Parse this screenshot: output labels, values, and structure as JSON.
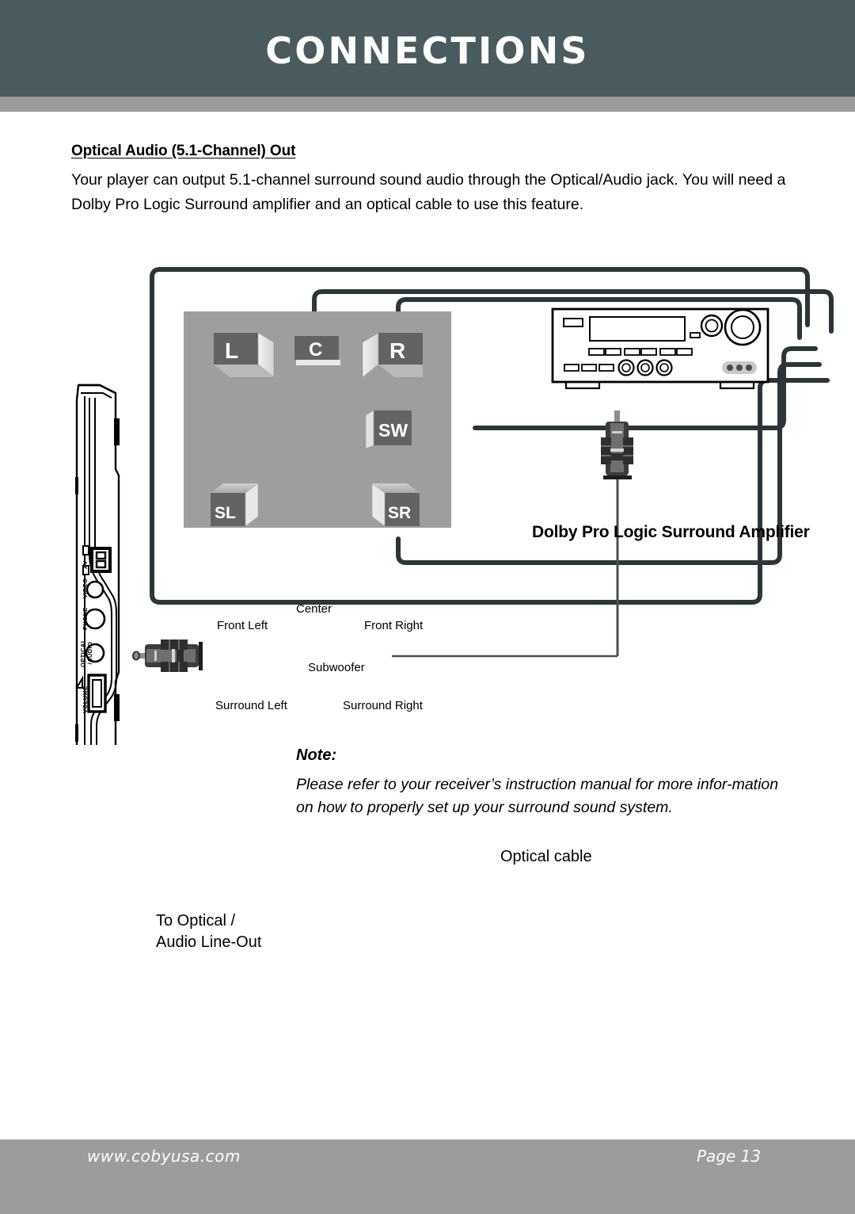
{
  "header": {
    "title": "CONNECTIONS"
  },
  "content": {
    "section_heading": "Optical Audio (5.1-Channel) Out",
    "paragraph": "Your player can output 5.1-channel surround sound audio through the Optical/Audio jack. You will need a Dolby Pro Logic Surround amplifier and an optical cable to use this feature."
  },
  "diagram": {
    "amplifier_title": "Dolby Pro Logic Surround Amplifier",
    "speakers": [
      {
        "code": "L",
        "label": "Front Left"
      },
      {
        "code": "C",
        "label": "Center"
      },
      {
        "code": "R",
        "label": "Front Right"
      },
      {
        "code": "SW",
        "label": "Subwoofer"
      },
      {
        "code": "SL",
        "label": "Surround Left"
      },
      {
        "code": "SR",
        "label": "Surround Right"
      }
    ],
    "cable_label": "Optical cable",
    "jack_label_line1": "To Optical /",
    "jack_label_line2": "Audio Line-Out",
    "player_ports": [
      {
        "name": "av",
        "label": "AV"
      },
      {
        "name": "video",
        "label": "VIDEO"
      },
      {
        "name": "phone",
        "label": "PHONE"
      },
      {
        "name": "optical-audio",
        "label": "OPTICAL\n/AUDIO"
      },
      {
        "name": "volume",
        "label": "VOLUME"
      }
    ]
  },
  "note": {
    "label": "Note:",
    "text": "Please refer to your receiver’s instruction manual for more infor-mation on how to properly set up your surround sound system."
  },
  "footer": {
    "url": "www.cobyusa.com",
    "page": "Page 13"
  },
  "colors": {
    "header_band": "#4a5b5f",
    "header_rule": "#9a9a9a",
    "footer_band": "#9c9c9c",
    "room_fill": "#9e9e9e",
    "speaker_dark": "#636363",
    "wire": "#2b3638"
  }
}
